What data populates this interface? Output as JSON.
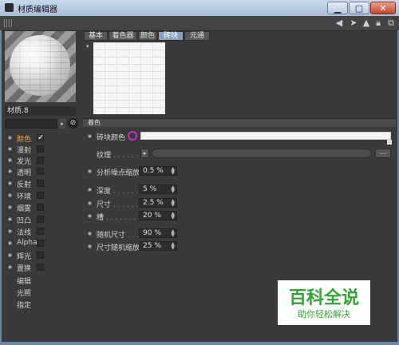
{
  "window": {
    "title": "材质编辑器",
    "minimize_icon": "minimize-icon",
    "maximize_icon": "maximize-icon",
    "close_icon": "close-icon"
  },
  "topbar": {
    "icons": [
      "back-arrow-icon",
      "cursor-icon",
      "up-arrow-icon",
      "lock-icon",
      "new-window-icon"
    ]
  },
  "material": {
    "name": "材质.8"
  },
  "channels": [
    {
      "label": "颜色",
      "enabled": true,
      "active": true
    },
    {
      "label": "漫射",
      "enabled": false
    },
    {
      "label": "发光",
      "enabled": false
    },
    {
      "label": "透明",
      "enabled": false
    },
    {
      "label": "反射",
      "enabled": false
    },
    {
      "label": "环境",
      "enabled": false
    },
    {
      "label": "烟雾",
      "enabled": false
    },
    {
      "label": "凹凸",
      "enabled": false
    },
    {
      "label": "法线",
      "enabled": false
    },
    {
      "label": "Alpha",
      "enabled": false
    },
    {
      "label": "辉光",
      "enabled": false
    },
    {
      "label": "置换",
      "enabled": false
    }
  ],
  "extra_items": [
    "编辑",
    "光照",
    "指定"
  ],
  "tabs": [
    "基本",
    "着色器",
    "颜色",
    "砖块",
    "元通"
  ],
  "active_tab": "砖块",
  "section": {
    "title": "着色"
  },
  "params": {
    "brick_color_label": "砖块颜色",
    "texture_label": "纹理",
    "texture_more": "...",
    "noise_scale": {
      "label": "分析噪点缩放",
      "value": "0.5 %"
    },
    "depth": {
      "label": "深度",
      "value": "5 %"
    },
    "size": {
      "label": "尺寸",
      "value": "2.5 %"
    },
    "grout": {
      "label": "槽",
      "value": "20 %"
    },
    "random_size": {
      "label": "随机尺寸",
      "value": "90 %"
    },
    "size_random_scale": {
      "label": "尺寸随机缩放",
      "value": "25 %"
    }
  },
  "watermark": {
    "title": "百科全说",
    "subtitle": "助你轻松解决"
  },
  "colors": {
    "accent_tab": "#8aa0c0",
    "active_channel": "#f0a040",
    "watermark_green": "#36a336",
    "picker_ring": "#c030c0"
  }
}
